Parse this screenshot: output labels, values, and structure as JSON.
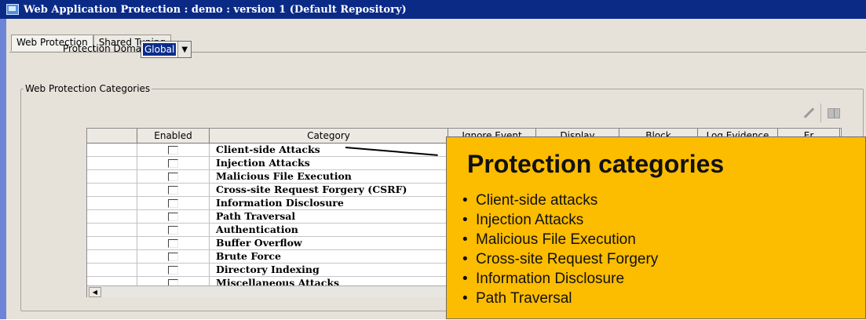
{
  "window": {
    "title": "Web Application Protection : demo : version 1 (Default Repository)"
  },
  "tabs": [
    {
      "label": "Web Protection"
    },
    {
      "label": "Shared Tuning"
    }
  ],
  "protection_domain": {
    "label": "Protection Domain:",
    "value": "Global"
  },
  "group": {
    "label": "Web Protection Categories"
  },
  "table": {
    "headers": [
      "Enabled",
      "Category",
      "Ignore Event",
      "Display",
      "Block",
      "Log Evidence",
      "Er"
    ],
    "rows": [
      {
        "enabled": false,
        "category": "Client-side Attacks"
      },
      {
        "enabled": false,
        "category": "Injection Attacks"
      },
      {
        "enabled": false,
        "category": "Malicious File Execution"
      },
      {
        "enabled": false,
        "category": "Cross-site Request Forgery (CSRF)"
      },
      {
        "enabled": false,
        "category": "Information Disclosure"
      },
      {
        "enabled": false,
        "category": "Path Traversal"
      },
      {
        "enabled": false,
        "category": "Authentication"
      },
      {
        "enabled": false,
        "category": "Buffer Overflow"
      },
      {
        "enabled": false,
        "category": "Brute Force"
      },
      {
        "enabled": false,
        "category": "Directory Indexing"
      },
      {
        "enabled": false,
        "category": "Miscellaneous Attacks"
      }
    ]
  },
  "callout": {
    "title": "Protection categories",
    "items": [
      "Client-side attacks",
      "Injection Attacks",
      "Malicious File Execution",
      "Cross-site Request Forgery",
      "Information Disclosure",
      "Path Traversal"
    ]
  },
  "icons": {
    "title": "app-window-icon",
    "edit": "pencil-icon",
    "book": "book-icon",
    "dropdown": "chevron-down-icon",
    "scroll": "scroll-left-icon"
  },
  "colors": {
    "titlebar": "#0a2a86",
    "callout": "#fcbc00",
    "selection": "#0b2c8c"
  }
}
